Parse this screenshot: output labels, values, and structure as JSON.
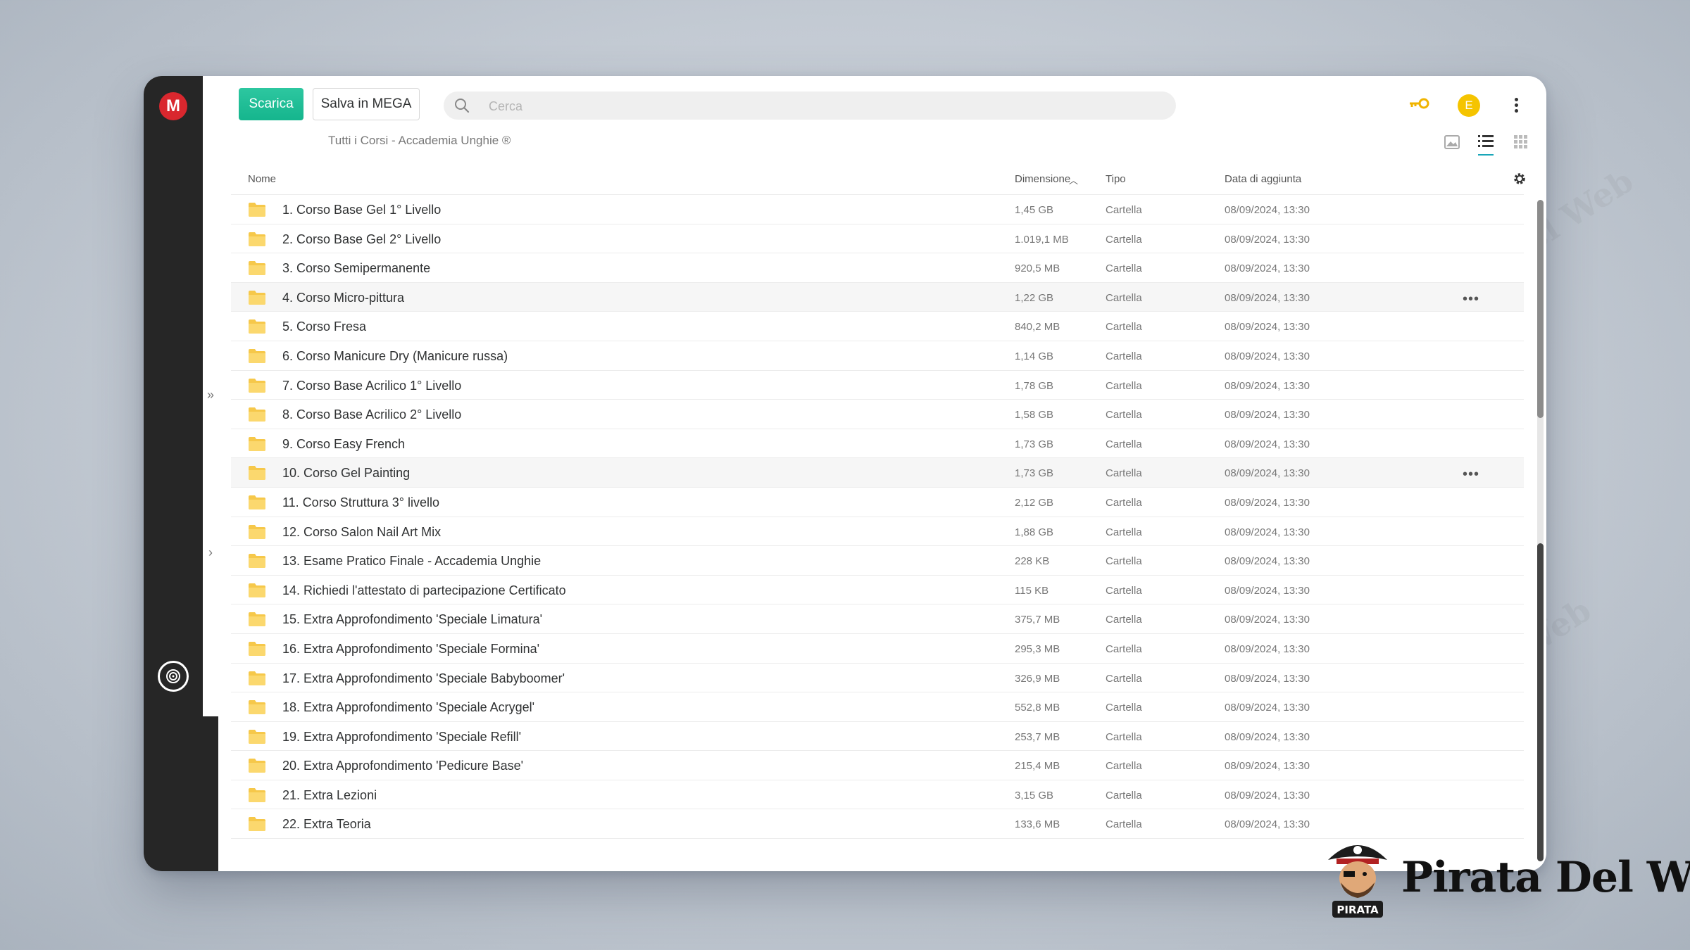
{
  "toolbar": {
    "download_label": "Scarica",
    "save_label": "Salva in MEGA",
    "search_placeholder": "Cerca",
    "avatar_letter": "E"
  },
  "breadcrumb": "Tutti i Corsi - Accademia Unghie ®",
  "columns": {
    "name": "Nome",
    "size": "Dimensione",
    "type": "Tipo",
    "date": "Data di aggiunta"
  },
  "rows": [
    {
      "name": "1. Corso Base Gel 1° Livello",
      "size": "1,45 GB",
      "type": "Cartella",
      "date": "08/09/2024, 13:30"
    },
    {
      "name": "2. Corso Base Gel 2° Livello",
      "size": "1.019,1 MB",
      "type": "Cartella",
      "date": "08/09/2024, 13:30"
    },
    {
      "name": "3. Corso Semipermanente",
      "size": "920,5 MB",
      "type": "Cartella",
      "date": "08/09/2024, 13:30"
    },
    {
      "name": "4. Corso Micro-pittura",
      "size": "1,22 GB",
      "type": "Cartella",
      "date": "08/09/2024, 13:30",
      "more": "•••"
    },
    {
      "name": "5. Corso Fresa",
      "size": "840,2 MB",
      "type": "Cartella",
      "date": "08/09/2024, 13:30"
    },
    {
      "name": "6. Corso Manicure Dry (Manicure russa)",
      "size": "1,14 GB",
      "type": "Cartella",
      "date": "08/09/2024, 13:30"
    },
    {
      "name": "7. Corso Base Acrilico 1° Livello",
      "size": "1,78 GB",
      "type": "Cartella",
      "date": "08/09/2024, 13:30"
    },
    {
      "name": "8. Corso Base Acrilico 2° Livello",
      "size": "1,58 GB",
      "type": "Cartella",
      "date": "08/09/2024, 13:30"
    },
    {
      "name": "9. Corso Easy French",
      "size": "1,73 GB",
      "type": "Cartella",
      "date": "08/09/2024, 13:30"
    },
    {
      "name": "10. Corso Gel Painting",
      "size": "1,73 GB",
      "type": "Cartella",
      "date": "08/09/2024, 13:30",
      "more": "•••"
    },
    {
      "name": "11. Corso Struttura 3° livello",
      "size": "2,12 GB",
      "type": "Cartella",
      "date": "08/09/2024, 13:30"
    },
    {
      "name": "12. Corso Salon Nail Art Mix",
      "size": "1,88 GB",
      "type": "Cartella",
      "date": "08/09/2024, 13:30"
    },
    {
      "name": "13. Esame Pratico Finale - Accademia Unghie",
      "size": "228 KB",
      "type": "Cartella",
      "date": "08/09/2024, 13:30"
    },
    {
      "name": "14. Richiedi l'attestato di partecipazione Certificato",
      "size": "115 KB",
      "type": "Cartella",
      "date": "08/09/2024, 13:30"
    },
    {
      "name": "15. Extra Approfondimento 'Speciale Limatura'",
      "size": "375,7 MB",
      "type": "Cartella",
      "date": "08/09/2024, 13:30"
    },
    {
      "name": "16. Extra Approfondimento 'Speciale Formina'",
      "size": "295,3 MB",
      "type": "Cartella",
      "date": "08/09/2024, 13:30"
    },
    {
      "name": "17. Extra Approfondimento 'Speciale Babyboomer'",
      "size": "326,9 MB",
      "type": "Cartella",
      "date": "08/09/2024, 13:30"
    },
    {
      "name": "18. Extra Approfondimento 'Speciale Acrygel'",
      "size": "552,8 MB",
      "type": "Cartella",
      "date": "08/09/2024, 13:30"
    },
    {
      "name": "19. Extra Approfondimento 'Speciale Refill'",
      "size": "253,7 MB",
      "type": "Cartella",
      "date": "08/09/2024, 13:30"
    },
    {
      "name": "20. Extra Approfondimento 'Pedicure Base'",
      "size": "215,4 MB",
      "type": "Cartella",
      "date": "08/09/2024, 13:30"
    },
    {
      "name": "21. Extra Lezioni",
      "size": "3,15 GB",
      "type": "Cartella",
      "date": "08/09/2024, 13:30"
    },
    {
      "name": "22. Extra Teoria",
      "size": "133,6 MB",
      "type": "Cartella",
      "date": "08/09/2024, 13:30"
    }
  ],
  "brand": {
    "name": "Pirata Del Web",
    "badge": "PIRATA",
    "watermark": "Pirata Del Web"
  },
  "colors": {
    "accent_green": "#1fbf94",
    "mega_red": "#d9272e",
    "avatar_yellow": "#f5c400",
    "folder_yellow": "#f6c84a",
    "sidebar_dark": "#262626"
  },
  "icons": {
    "logo": "mega-logo",
    "search": "search-icon",
    "key": "key-icon",
    "menu": "kebab-menu-icon",
    "folder": "folder-icon",
    "settings": "gear-icon",
    "fingerprint": "fingerprint-icon"
  }
}
